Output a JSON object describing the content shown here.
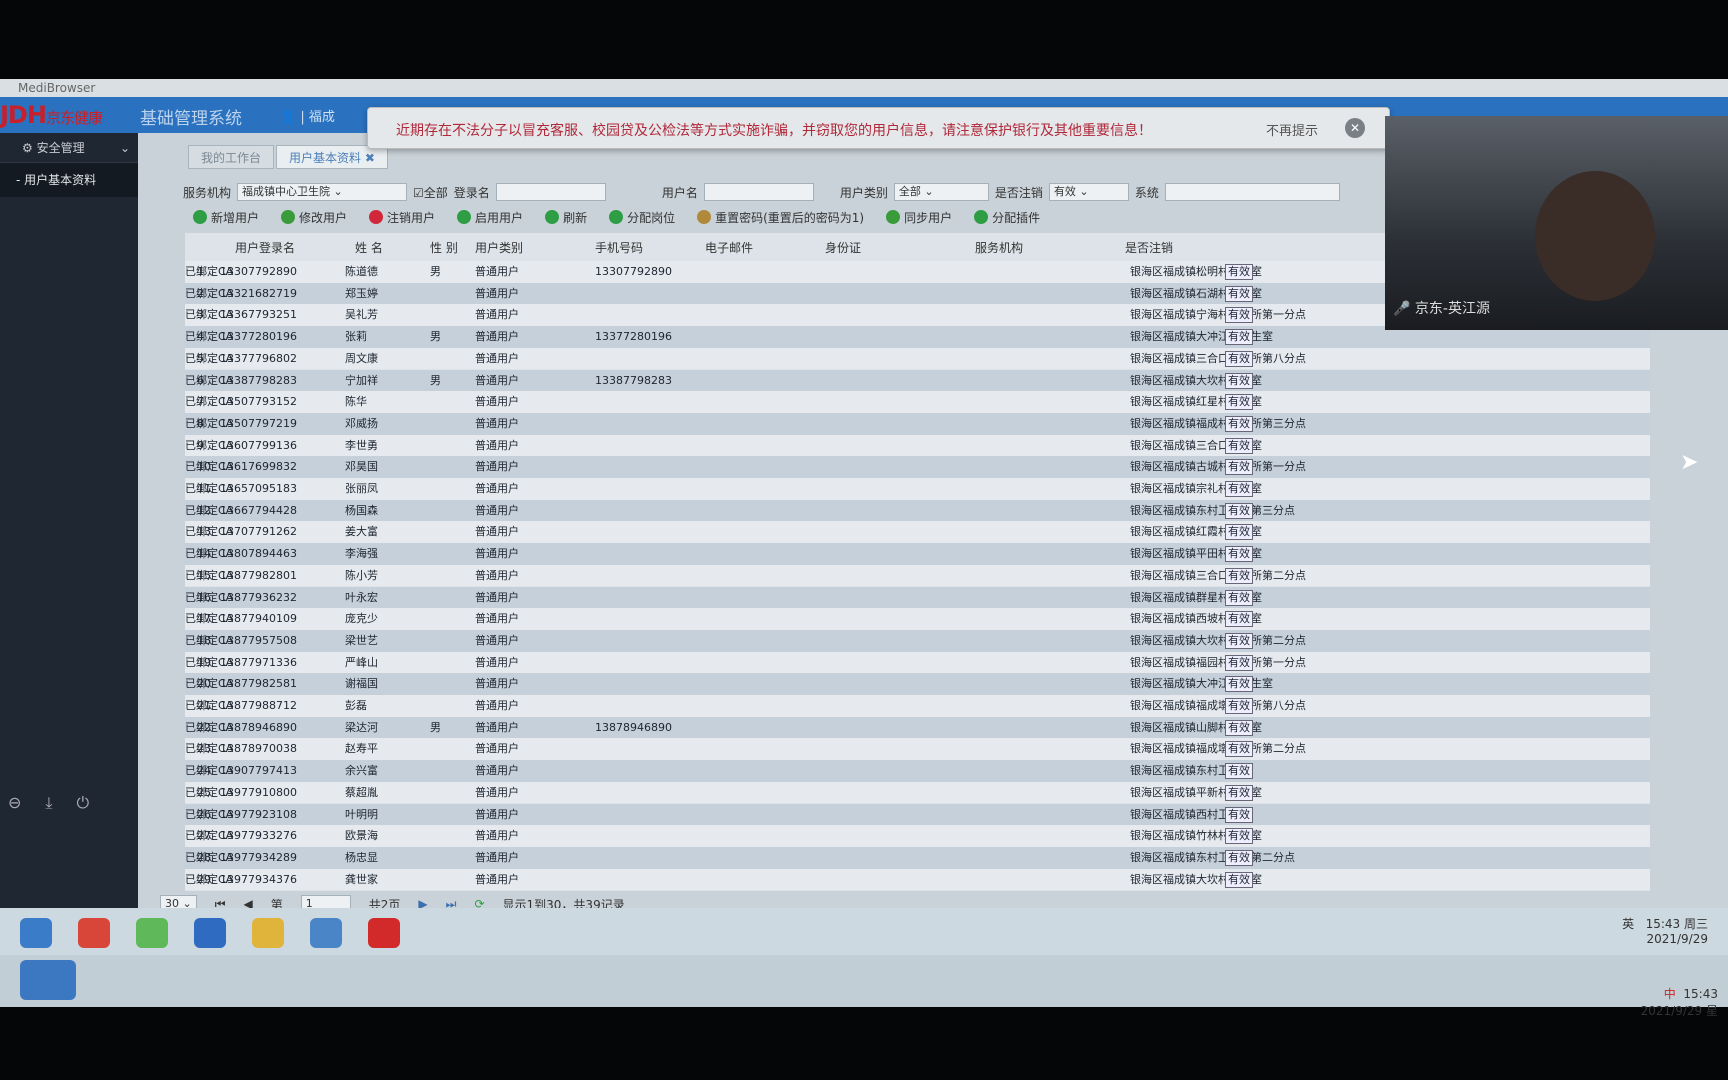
{
  "window": {
    "title": "MediBrowser"
  },
  "header": {
    "logo": "JDH",
    "logo_sub": "京东健康",
    "system_name": "基础管理系统",
    "user": "福成"
  },
  "sidebar": {
    "group": "安全管理",
    "items": [
      {
        "label": "- 用户基本资料"
      }
    ]
  },
  "tabs": [
    {
      "label": "我的工作台"
    },
    {
      "label": "用户基本资料 ✖"
    }
  ],
  "filters": {
    "org_label": "服务机构",
    "org_value": "福成镇中心卫生院",
    "all_label": "全部",
    "login_label": "登录名",
    "login_value": "",
    "username_label": "用户名",
    "username_value": "",
    "type_label": "用户类别",
    "type_value": "全部",
    "cancel_label": "是否注销",
    "cancel_value": "有效",
    "system_label": "系统",
    "system_value": ""
  },
  "toolbar": [
    {
      "label": "新增用户",
      "icon": "plus-icon",
      "color": "#2e9d44"
    },
    {
      "label": "修改用户",
      "icon": "pencil-icon",
      "color": "#3a9b3a"
    },
    {
      "label": "注销用户",
      "icon": "x-icon",
      "color": "#d0283a"
    },
    {
      "label": "启用用户",
      "icon": "plus-icon",
      "color": "#2e9d44"
    },
    {
      "label": "刷新",
      "icon": "refresh-icon",
      "color": "#2e9d44"
    },
    {
      "label": "分配岗位",
      "icon": "plus-icon",
      "color": "#2e9d44"
    },
    {
      "label": "重置密码(重置后的密码为1)",
      "icon": "key-icon",
      "color": "#b08a3a"
    },
    {
      "label": "同步用户",
      "icon": "check-icon",
      "color": "#3a9b3a"
    },
    {
      "label": "分配插件",
      "icon": "plus-icon",
      "color": "#2e9d44"
    }
  ],
  "columns": [
    "用户登录名",
    "姓 名",
    "性 别",
    "用户类别",
    "手机号码",
    "电子邮件",
    "身份证",
    "服务机构",
    "是否注销"
  ],
  "rows": [
    [
      "1",
      "13307792890",
      "陈道德",
      "男",
      "普通用户",
      "13307792890",
      "",
      "银海区福成镇松明村卫生室",
      "有效",
      "已绑定CA"
    ],
    [
      "2",
      "13321682719",
      "郑玉婷",
      "",
      "普通用户",
      "",
      "",
      "银海区福成镇石湖村卫生室",
      "有效",
      "已绑定CA"
    ],
    [
      "3",
      "13367793251",
      "吴礼芳",
      "",
      "普通用户",
      "",
      "",
      "银海区福成镇宁海村卫生所第一分点",
      "有效",
      "已绑定CA"
    ],
    [
      "4",
      "13377280196",
      "张莉",
      "男",
      "普通用户",
      "13377280196",
      "",
      "银海区福成镇大冲江村卫生室",
      "有效",
      "已绑定CA"
    ],
    [
      "5",
      "13377796802",
      "周文康",
      "",
      "普通用户",
      "",
      "",
      "银海区福成镇三合口卫生所第八分点",
      "有效",
      "已绑定CA"
    ],
    [
      "6",
      "13387798283",
      "宁加祥",
      "男",
      "普通用户",
      "13387798283",
      "",
      "银海区福成镇大坎村卫生室",
      "有效",
      "已绑定CA"
    ],
    [
      "7",
      "13507793152",
      "陈华",
      "",
      "普通用户",
      "",
      "",
      "银海区福成镇红星村卫生室",
      "有效",
      "已绑定CA"
    ],
    [
      "8",
      "13507797219",
      "邓威扬",
      "",
      "普通用户",
      "",
      "",
      "银海区福成镇福成村卫生所第三分点",
      "有效",
      "已绑定CA"
    ],
    [
      "9",
      "13607799136",
      "李世勇",
      "",
      "普通用户",
      "",
      "",
      "银海区福成镇三合口卫生室",
      "有效",
      "已绑定CA"
    ],
    [
      "10",
      "13617699832",
      "邓昊国",
      "",
      "普通用户",
      "",
      "",
      "银海区福成镇古城村卫生所第一分点",
      "有效",
      "已绑定CA"
    ],
    [
      "11",
      "13657095183",
      "张丽凤",
      "",
      "普通用户",
      "",
      "",
      "银海区福成镇宗礼村卫生室",
      "有效",
      "已绑定CA"
    ],
    [
      "12",
      "13667794428",
      "杨国森",
      "",
      "普通用户",
      "",
      "",
      "银海区福成镇东村卫生所第三分点",
      "有效",
      "已绑定CA"
    ],
    [
      "13",
      "13707791262",
      "姜大富",
      "",
      "普通用户",
      "",
      "",
      "银海区福成镇红霞村卫生室",
      "有效",
      "已绑定CA"
    ],
    [
      "14",
      "13807894463",
      "李海强",
      "",
      "普通用户",
      "",
      "",
      "银海区福成镇平田村卫生室",
      "有效",
      "已绑定CA"
    ],
    [
      "15",
      "13877982801",
      "陈小芳",
      "",
      "普通用户",
      "",
      "",
      "银海区福成镇三合口卫生所第二分点",
      "有效",
      "已绑定CA"
    ],
    [
      "16",
      "13877936232",
      "叶永宏",
      "",
      "普通用户",
      "",
      "",
      "银海区福成镇群星村卫生室",
      "有效",
      "已绑定CA"
    ],
    [
      "17",
      "13877940109",
      "庞克少",
      "",
      "普通用户",
      "",
      "",
      "银海区福成镇西坡村卫生室",
      "有效",
      "已绑定CA"
    ],
    [
      "18",
      "13877957508",
      "梁世艺",
      "",
      "普通用户",
      "",
      "",
      "银海区福成镇大坎村卫生所第二分点",
      "有效",
      "已绑定CA"
    ],
    [
      "19",
      "13877971336",
      "严峰山",
      "",
      "普通用户",
      "",
      "",
      "银海区福成镇福园村卫生所第一分点",
      "有效",
      "已绑定CA"
    ],
    [
      "20",
      "13877982581",
      "谢福国",
      "",
      "普通用户",
      "",
      "",
      "银海区福成镇大冲江村卫生室",
      "有效",
      "已绑定CA"
    ],
    [
      "21",
      "13877988712",
      "彭磊",
      "",
      "普通用户",
      "",
      "",
      "银海区福成镇福成墩卫生所第八分点",
      "有效",
      "已绑定CA"
    ],
    [
      "22",
      "13878946890",
      "梁达河",
      "男",
      "普通用户",
      "13878946890",
      "",
      "银海区福成镇山脚村卫生室",
      "有效",
      "已绑定CA"
    ],
    [
      "23",
      "13878970038",
      "赵寿平",
      "",
      "普通用户",
      "",
      "",
      "银海区福成镇福成墩卫生所第二分点",
      "有效",
      "已绑定CA"
    ],
    [
      "24",
      "13907797413",
      "余兴富",
      "",
      "普通用户",
      "",
      "",
      "银海区福成镇东村卫生室",
      "有效",
      "已绑定CA"
    ],
    [
      "25",
      "13977910800",
      "蔡超胤",
      "",
      "普通用户",
      "",
      "",
      "银海区福成镇平新村卫生室",
      "有效",
      "已绑定CA"
    ],
    [
      "26",
      "13977923108",
      "叶明明",
      "",
      "普通用户",
      "",
      "",
      "银海区福成镇西村卫生室",
      "有效",
      "已绑定CA"
    ],
    [
      "27",
      "13977933276",
      "欧景海",
      "",
      "普通用户",
      "",
      "",
      "银海区福成镇竹林村卫生室",
      "有效",
      "已绑定CA"
    ],
    [
      "28",
      "13977934289",
      "杨忠显",
      "",
      "普通用户",
      "",
      "",
      "银海区福成镇东村卫生所第二分点",
      "有效",
      "已绑定CA"
    ],
    [
      "29",
      "13977934376",
      "龚世家",
      "",
      "普通用户",
      "",
      "",
      "银海区福成镇大坎村卫生室",
      "有效",
      "已绑定CA"
    ]
  ],
  "pager": {
    "page_size": "30",
    "page_label": "第",
    "page_value": "1",
    "total_pages": "共2页",
    "summary": "显示1到30，共39记录"
  },
  "notice": {
    "text": "近期存在不法分子以冒充客服、校园贷及公检法等方式实施诈骗，并窃取您的用户信息，请注意保护银行及其他重要信息！",
    "dismiss": "不再提示"
  },
  "video": {
    "label": "京东-英江源"
  },
  "tray": {
    "time": "15:43 周三",
    "date": "2021/9/29",
    "time2": "15:43",
    "date2": "2021/9/29 星",
    "ime": "英",
    "ime2": "中"
  }
}
